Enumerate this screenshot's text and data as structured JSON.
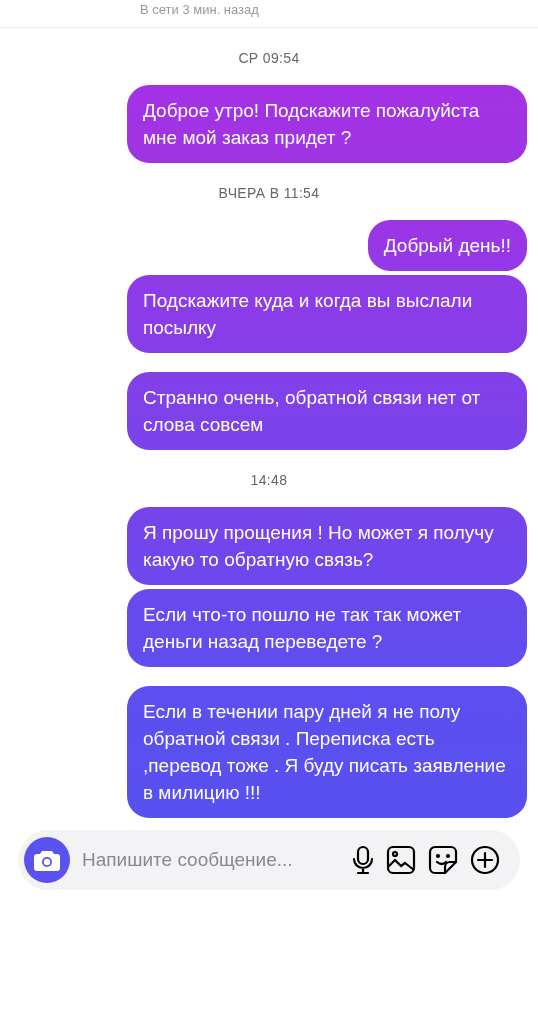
{
  "header": {
    "status": "В сети 3 мин. назад"
  },
  "sections": [
    {
      "time": "СР 09:54",
      "clusters": [
        [
          "Доброе утро! Подскажите пожалуйста мне мой заказ придет ?"
        ]
      ]
    },
    {
      "time": "ВЧЕРА В 11:54",
      "clusters": [
        [
          "Добрый день!!",
          "Подскажите куда и когда вы выслали посылку"
        ],
        [
          "Странно очень, обратной связи нет от слова совсем"
        ]
      ]
    },
    {
      "time": "14:48",
      "clusters": [
        [
          "Я прошу прощения ! Но может я получу какую то обратную связь?",
          "Если что-то пошло не так так может деньги назад переведете ?"
        ],
        [
          "Если в течении пару дней я не полу обратной связи . Переписка есть ,перевод тоже . Я буду писать заявление в милицию !!!"
        ]
      ]
    }
  ],
  "composer": {
    "placeholder": "Напишите сообщение..."
  }
}
